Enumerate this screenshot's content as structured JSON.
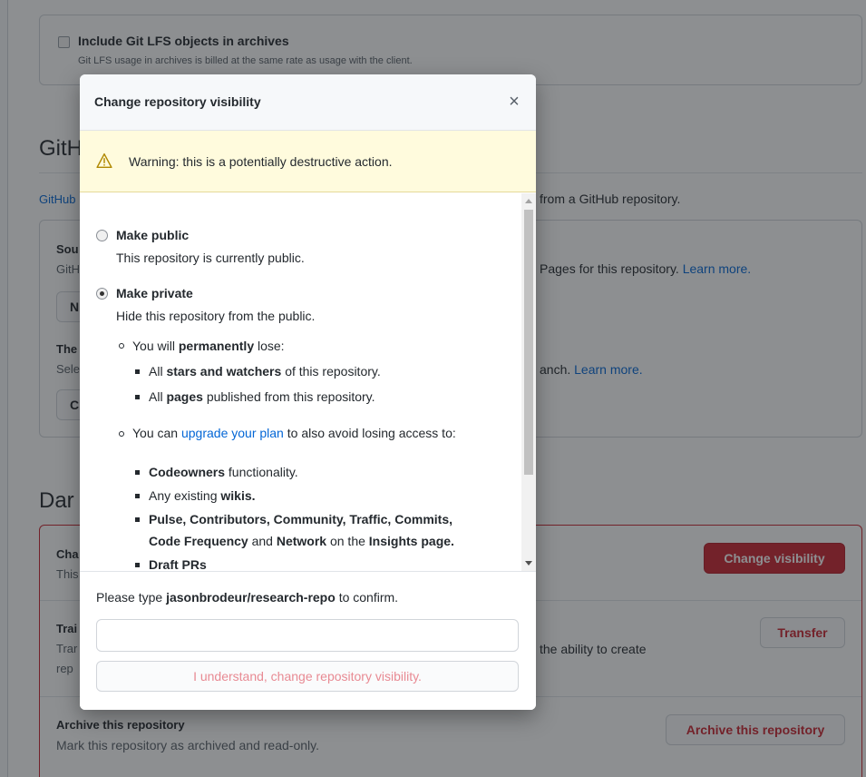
{
  "background": {
    "lfs": {
      "checkbox_label": "Include Git LFS objects in archives",
      "description": "Git LFS usage in archives is billed at the same rate as usage with the client."
    },
    "pages_section": {
      "heading_fragment": "GitH",
      "intro_fragment": "GitHub",
      "intro_tail": "from a GitHub repository.",
      "source_fragment": "Sou",
      "source_desc_fragment": "GitH",
      "source_desc_tail": "Pages for this repository.",
      "learn_more": "Learn more.",
      "button_fragment": "N",
      "theme_fragment": "The",
      "theme_desc_fragment": "Sele",
      "theme_desc_tail": "anch.",
      "theme_learn_more": "Learn more.",
      "theme_button_fragment": "C"
    },
    "danger_zone": {
      "heading_fragment": "Dar",
      "change_title_fragment": "Cha",
      "change_desc_fragment": "This",
      "change_button": "Change visibility",
      "transfer_title_fragment": "Trai",
      "transfer_desc_fragment": "Trar",
      "transfer_desc_tail": "the ability to create",
      "transfer_desc_line2_fragment": "rep",
      "transfer_button": "Transfer",
      "archive_title": "Archive this repository",
      "archive_desc": "Mark this repository as archived and read-only.",
      "archive_button": "Archive this repository"
    }
  },
  "dialog": {
    "title": "Change repository visibility",
    "close_glyph": "×",
    "warning": "Warning: this is a potentially destructive action.",
    "options": {
      "public": {
        "label": "Make public",
        "description": "This repository is currently public."
      },
      "private": {
        "label": "Make private",
        "description": "Hide this repository from the public."
      }
    },
    "lose": {
      "prefix": "You will",
      "emphasis": "permanently",
      "suffix": "lose:",
      "items": [
        {
          "pre": "All",
          "bold": "stars and watchers",
          "post": "of this repository."
        },
        {
          "pre": "All",
          "bold": "pages",
          "post": "published from this repository."
        }
      ]
    },
    "upgrade": {
      "prefix": "You can",
      "link": "upgrade your plan",
      "suffix": "to also avoid losing access to:",
      "codeowners_bold": "Codeowners",
      "codeowners_post": "functionality.",
      "wikis_pre": "Any existing",
      "wikis_bold": "wikis.",
      "insights_line1": "Pulse, Contributors, Community, Traffic, Commits,",
      "insights_line2_bold1": "Code Frequency",
      "insights_line2_and": "and",
      "insights_line2_bold2": "Network",
      "insights_line2_on": "on the",
      "insights_line2_bold3": "Insights page.",
      "draft_prs_fragment": "Draft PRs"
    },
    "confirm": {
      "prefix": "Please type",
      "repo": "jasonbrodeur/research-repo",
      "suffix": "to confirm.",
      "input_value": "",
      "input_placeholder": "",
      "button": "I understand, change repository visibility."
    }
  }
}
